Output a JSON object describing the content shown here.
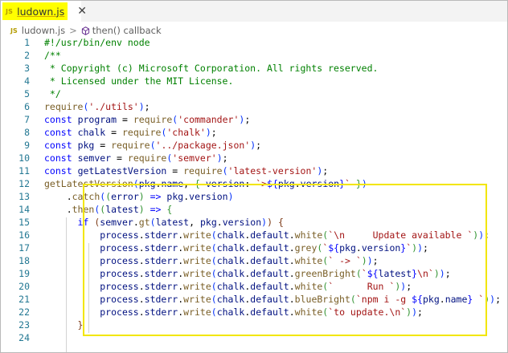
{
  "tab": {
    "icon": "JS",
    "filename": "ludown.js",
    "close_icon": "close-icon"
  },
  "breadcrumb": {
    "icon": "JS",
    "file": "ludown.js",
    "separator": ">",
    "symbol_icon": "cube-icon",
    "symbol": "then() callback"
  },
  "highlight": {
    "color": "#f2e600",
    "from_line": 15,
    "to_line": 23
  },
  "code_lines": [
    {
      "n": "1",
      "tokens": [
        [
          "cmt",
          "#!/usr/bin/env node"
        ]
      ]
    },
    {
      "n": "2",
      "tokens": [
        [
          "cmt",
          "/**"
        ]
      ]
    },
    {
      "n": "3",
      "tokens": [
        [
          "cmt",
          " * Copyright (c) Microsoft Corporation. All rights reserved."
        ]
      ]
    },
    {
      "n": "4",
      "tokens": [
        [
          "cmt",
          " * Licensed under the MIT License."
        ]
      ]
    },
    {
      "n": "5",
      "tokens": [
        [
          "cmt",
          " */"
        ]
      ]
    },
    {
      "n": "6",
      "tokens": [
        [
          "fn",
          "require"
        ],
        [
          "br1",
          "("
        ],
        [
          "str",
          "'./utils'"
        ],
        [
          "br1",
          ")"
        ],
        [
          "pl",
          ";"
        ]
      ]
    },
    {
      "n": "7",
      "tokens": [
        [
          "kw",
          "const"
        ],
        [
          "pl",
          " "
        ],
        [
          "var",
          "program"
        ],
        [
          "pl",
          " = "
        ],
        [
          "fn",
          "require"
        ],
        [
          "br1",
          "("
        ],
        [
          "str",
          "'commander'"
        ],
        [
          "br1",
          ")"
        ],
        [
          "pl",
          ";"
        ]
      ]
    },
    {
      "n": "8",
      "tokens": [
        [
          "kw",
          "const"
        ],
        [
          "pl",
          " "
        ],
        [
          "var",
          "chalk"
        ],
        [
          "pl",
          " = "
        ],
        [
          "fn",
          "require"
        ],
        [
          "br1",
          "("
        ],
        [
          "str",
          "'chalk'"
        ],
        [
          "br1",
          ")"
        ],
        [
          "pl",
          ";"
        ]
      ]
    },
    {
      "n": "9",
      "tokens": [
        [
          "kw",
          "const"
        ],
        [
          "pl",
          " "
        ],
        [
          "var",
          "pkg"
        ],
        [
          "pl",
          " = "
        ],
        [
          "fn",
          "require"
        ],
        [
          "br1",
          "("
        ],
        [
          "str",
          "'../package.json'"
        ],
        [
          "br1",
          ")"
        ],
        [
          "pl",
          ";"
        ]
      ]
    },
    {
      "n": "10",
      "tokens": [
        [
          "kw",
          "const"
        ],
        [
          "pl",
          " "
        ],
        [
          "var",
          "semver"
        ],
        [
          "pl",
          " = "
        ],
        [
          "fn",
          "require"
        ],
        [
          "br1",
          "("
        ],
        [
          "str",
          "'semver'"
        ],
        [
          "br1",
          ")"
        ],
        [
          "pl",
          ";"
        ]
      ]
    },
    {
      "n": "11",
      "tokens": [
        [
          "kw",
          "const"
        ],
        [
          "pl",
          " "
        ],
        [
          "var",
          "getLatestVersion"
        ],
        [
          "pl",
          " = "
        ],
        [
          "fn",
          "require"
        ],
        [
          "br1",
          "("
        ],
        [
          "str",
          "'latest-version'"
        ],
        [
          "br1",
          ")"
        ],
        [
          "pl",
          ";"
        ]
      ]
    },
    {
      "n": "12",
      "tokens": [
        [
          "fn",
          "getLatestVersion"
        ],
        [
          "br1",
          "("
        ],
        [
          "var",
          "pkg"
        ],
        [
          "pl",
          "."
        ],
        [
          "var",
          "name"
        ],
        [
          "pl",
          ", "
        ],
        [
          "br2",
          "{"
        ],
        [
          "pl",
          " "
        ],
        [
          "var",
          "version"
        ],
        [
          "pl",
          ": "
        ],
        [
          "str",
          "`>"
        ],
        [
          "kw",
          "${"
        ],
        [
          "var",
          "pkg"
        ],
        [
          "pl",
          "."
        ],
        [
          "var",
          "version"
        ],
        [
          "kw",
          "}"
        ],
        [
          "str",
          "`"
        ],
        [
          "pl",
          " "
        ],
        [
          "br2",
          "}"
        ],
        [
          "br1",
          ")"
        ]
      ]
    },
    {
      "n": "13",
      "tokens": [
        [
          "pl",
          "    ."
        ],
        [
          "fn",
          "catch"
        ],
        [
          "br1",
          "("
        ],
        [
          "br2",
          "("
        ],
        [
          "var",
          "error"
        ],
        [
          "br2",
          ")"
        ],
        [
          "pl",
          " "
        ],
        [
          "kw",
          "=>"
        ],
        [
          "pl",
          " "
        ],
        [
          "var",
          "pkg"
        ],
        [
          "pl",
          "."
        ],
        [
          "var",
          "version"
        ],
        [
          "br1",
          ")"
        ]
      ]
    },
    {
      "n": "14",
      "tokens": [
        [
          "pl",
          "    ."
        ],
        [
          "fn",
          "then"
        ],
        [
          "br1",
          "("
        ],
        [
          "br2",
          "("
        ],
        [
          "var",
          "latest"
        ],
        [
          "br2",
          ")"
        ],
        [
          "pl",
          " "
        ],
        [
          "kw",
          "=>"
        ],
        [
          "pl",
          " "
        ],
        [
          "br2",
          "{"
        ]
      ]
    },
    {
      "n": "15",
      "tokens": [
        [
          "pl",
          "      "
        ],
        [
          "kw",
          "if"
        ],
        [
          "pl",
          " "
        ],
        [
          "br3",
          "("
        ],
        [
          "var",
          "semver"
        ],
        [
          "pl",
          "."
        ],
        [
          "fn",
          "gt"
        ],
        [
          "br1",
          "("
        ],
        [
          "var",
          "latest"
        ],
        [
          "pl",
          ", "
        ],
        [
          "var",
          "pkg"
        ],
        [
          "pl",
          "."
        ],
        [
          "var",
          "version"
        ],
        [
          "br1",
          ")"
        ],
        [
          "br3",
          ")"
        ],
        [
          "pl",
          " "
        ],
        [
          "br3",
          "{"
        ]
      ]
    },
    {
      "n": "16",
      "tokens": [
        [
          "pl",
          "          "
        ],
        [
          "var",
          "process"
        ],
        [
          "pl",
          "."
        ],
        [
          "var",
          "stderr"
        ],
        [
          "pl",
          "."
        ],
        [
          "fn",
          "write"
        ],
        [
          "br1",
          "("
        ],
        [
          "var",
          "chalk"
        ],
        [
          "pl",
          "."
        ],
        [
          "var",
          "default"
        ],
        [
          "pl",
          "."
        ],
        [
          "fn",
          "white"
        ],
        [
          "br2",
          "("
        ],
        [
          "str",
          "`\\n     Update available `"
        ],
        [
          "br2",
          ")"
        ],
        [
          "br1",
          ")"
        ],
        [
          "pl",
          ";"
        ]
      ]
    },
    {
      "n": "17",
      "tokens": [
        [
          "pl",
          "          "
        ],
        [
          "var",
          "process"
        ],
        [
          "pl",
          "."
        ],
        [
          "var",
          "stderr"
        ],
        [
          "pl",
          "."
        ],
        [
          "fn",
          "write"
        ],
        [
          "br1",
          "("
        ],
        [
          "var",
          "chalk"
        ],
        [
          "pl",
          "."
        ],
        [
          "var",
          "default"
        ],
        [
          "pl",
          "."
        ],
        [
          "fn",
          "grey"
        ],
        [
          "br2",
          "("
        ],
        [
          "str",
          "`"
        ],
        [
          "kw",
          "${"
        ],
        [
          "var",
          "pkg"
        ],
        [
          "pl",
          "."
        ],
        [
          "var",
          "version"
        ],
        [
          "kw",
          "}"
        ],
        [
          "str",
          "`"
        ],
        [
          "br2",
          ")"
        ],
        [
          "br1",
          ")"
        ],
        [
          "pl",
          ";"
        ]
      ]
    },
    {
      "n": "18",
      "tokens": [
        [
          "pl",
          "          "
        ],
        [
          "var",
          "process"
        ],
        [
          "pl",
          "."
        ],
        [
          "var",
          "stderr"
        ],
        [
          "pl",
          "."
        ],
        [
          "fn",
          "write"
        ],
        [
          "br1",
          "("
        ],
        [
          "var",
          "chalk"
        ],
        [
          "pl",
          "."
        ],
        [
          "var",
          "default"
        ],
        [
          "pl",
          "."
        ],
        [
          "fn",
          "white"
        ],
        [
          "br2",
          "("
        ],
        [
          "str",
          "` -> `"
        ],
        [
          "br2",
          ")"
        ],
        [
          "br1",
          ")"
        ],
        [
          "pl",
          ";"
        ]
      ]
    },
    {
      "n": "19",
      "tokens": [
        [
          "pl",
          "          "
        ],
        [
          "var",
          "process"
        ],
        [
          "pl",
          "."
        ],
        [
          "var",
          "stderr"
        ],
        [
          "pl",
          "."
        ],
        [
          "fn",
          "write"
        ],
        [
          "br1",
          "("
        ],
        [
          "var",
          "chalk"
        ],
        [
          "pl",
          "."
        ],
        [
          "var",
          "default"
        ],
        [
          "pl",
          "."
        ],
        [
          "fn",
          "greenBright"
        ],
        [
          "br2",
          "("
        ],
        [
          "str",
          "`"
        ],
        [
          "kw",
          "${"
        ],
        [
          "var",
          "latest"
        ],
        [
          "kw",
          "}"
        ],
        [
          "str",
          "\\n`"
        ],
        [
          "br2",
          ")"
        ],
        [
          "br1",
          ")"
        ],
        [
          "pl",
          ";"
        ]
      ]
    },
    {
      "n": "20",
      "tokens": [
        [
          "pl",
          "          "
        ],
        [
          "var",
          "process"
        ],
        [
          "pl",
          "."
        ],
        [
          "var",
          "stderr"
        ],
        [
          "pl",
          "."
        ],
        [
          "fn",
          "write"
        ],
        [
          "br1",
          "("
        ],
        [
          "var",
          "chalk"
        ],
        [
          "pl",
          "."
        ],
        [
          "var",
          "default"
        ],
        [
          "pl",
          "."
        ],
        [
          "fn",
          "white"
        ],
        [
          "br2",
          "("
        ],
        [
          "str",
          "`      Run `"
        ],
        [
          "br2",
          ")"
        ],
        [
          "br1",
          ")"
        ],
        [
          "pl",
          ";"
        ]
      ]
    },
    {
      "n": "21",
      "tokens": [
        [
          "pl",
          "          "
        ],
        [
          "var",
          "process"
        ],
        [
          "pl",
          "."
        ],
        [
          "var",
          "stderr"
        ],
        [
          "pl",
          "."
        ],
        [
          "fn",
          "write"
        ],
        [
          "br1",
          "("
        ],
        [
          "var",
          "chalk"
        ],
        [
          "pl",
          "."
        ],
        [
          "var",
          "default"
        ],
        [
          "pl",
          "."
        ],
        [
          "fn",
          "blueBright"
        ],
        [
          "br2",
          "("
        ],
        [
          "str",
          "`npm i -g "
        ],
        [
          "kw",
          "${"
        ],
        [
          "var",
          "pkg"
        ],
        [
          "pl",
          "."
        ],
        [
          "var",
          "name"
        ],
        [
          "kw",
          "}"
        ],
        [
          "str",
          " `"
        ],
        [
          "br2",
          ")"
        ],
        [
          "br1",
          ")"
        ],
        [
          "pl",
          ";"
        ]
      ]
    },
    {
      "n": "22",
      "tokens": [
        [
          "pl",
          "          "
        ],
        [
          "var",
          "process"
        ],
        [
          "pl",
          "."
        ],
        [
          "var",
          "stderr"
        ],
        [
          "pl",
          "."
        ],
        [
          "fn",
          "write"
        ],
        [
          "br1",
          "("
        ],
        [
          "var",
          "chalk"
        ],
        [
          "pl",
          "."
        ],
        [
          "var",
          "default"
        ],
        [
          "pl",
          "."
        ],
        [
          "fn",
          "white"
        ],
        [
          "br2",
          "("
        ],
        [
          "str",
          "`to update.\\n`"
        ],
        [
          "br2",
          ")"
        ],
        [
          "br1",
          ")"
        ],
        [
          "pl",
          ";"
        ]
      ]
    },
    {
      "n": "23",
      "tokens": [
        [
          "pl",
          "      "
        ],
        [
          "br3",
          "}"
        ]
      ]
    },
    {
      "n": "24",
      "tokens": []
    }
  ]
}
